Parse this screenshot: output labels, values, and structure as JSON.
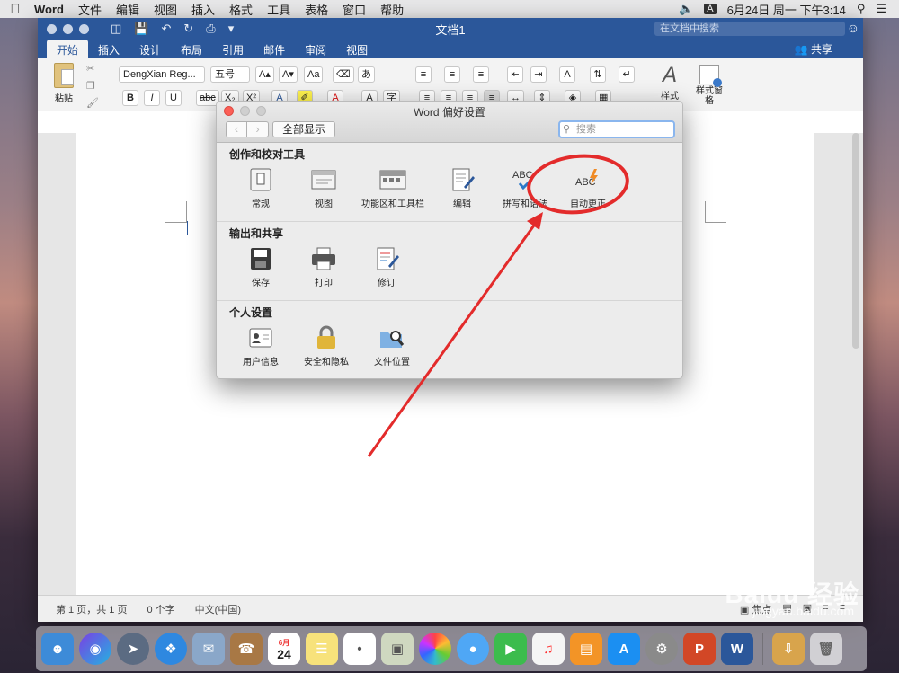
{
  "menubar": {
    "app_name": "Word",
    "items": [
      "文件",
      "编辑",
      "视图",
      "插入",
      "格式",
      "工具",
      "表格",
      "窗口",
      "帮助"
    ],
    "ime": "A",
    "datetime": "6月24日 周一 下午3:14"
  },
  "word": {
    "doc_title": "文档1",
    "search_placeholder": "在文档中搜索",
    "tabs": [
      "开始",
      "插入",
      "设计",
      "布局",
      "引用",
      "邮件",
      "审阅",
      "视图"
    ],
    "share_label": "共享",
    "ribbon": {
      "paste_label": "粘贴",
      "font_name": "DengXian Reg...",
      "font_size": "五号",
      "styles_label": "样式",
      "styles_pane_label": "样式窗格"
    },
    "status": {
      "page": "第 1 页，共 1 页",
      "words": "0 个字",
      "language": "中文(中国)",
      "focus": "焦点"
    }
  },
  "prefs": {
    "title": "Word 偏好设置",
    "show_all": "全部显示",
    "search_placeholder": "搜索",
    "sections": [
      {
        "title": "创作和校对工具",
        "items": [
          {
            "label": "常规",
            "icon": "general-icon"
          },
          {
            "label": "视图",
            "icon": "view-icon"
          },
          {
            "label": "功能区和工具栏",
            "icon": "ribbon-toolbar-icon"
          },
          {
            "label": "编辑",
            "icon": "edit-icon"
          },
          {
            "label": "拼写和语法",
            "icon": "spelling-grammar-icon"
          },
          {
            "label": "自动更正",
            "icon": "autocorrect-icon"
          }
        ]
      },
      {
        "title": "输出和共享",
        "items": [
          {
            "label": "保存",
            "icon": "save-icon"
          },
          {
            "label": "打印",
            "icon": "print-icon"
          },
          {
            "label": "修订",
            "icon": "track-changes-icon"
          }
        ]
      },
      {
        "title": "个人设置",
        "items": [
          {
            "label": "用户信息",
            "icon": "user-info-icon"
          },
          {
            "label": "安全和隐私",
            "icon": "security-privacy-icon"
          },
          {
            "label": "文件位置",
            "icon": "file-locations-icon"
          }
        ]
      }
    ]
  },
  "dock": {
    "date_icon_month": "6月",
    "date_icon_day": "24"
  },
  "watermark": {
    "brand": "Baidu 经验",
    "url": "jingyan.baidu.com"
  },
  "colors": {
    "word_blue": "#2b579a",
    "annotation_red": "#e32b2b",
    "close_red": "#fc5f57"
  }
}
